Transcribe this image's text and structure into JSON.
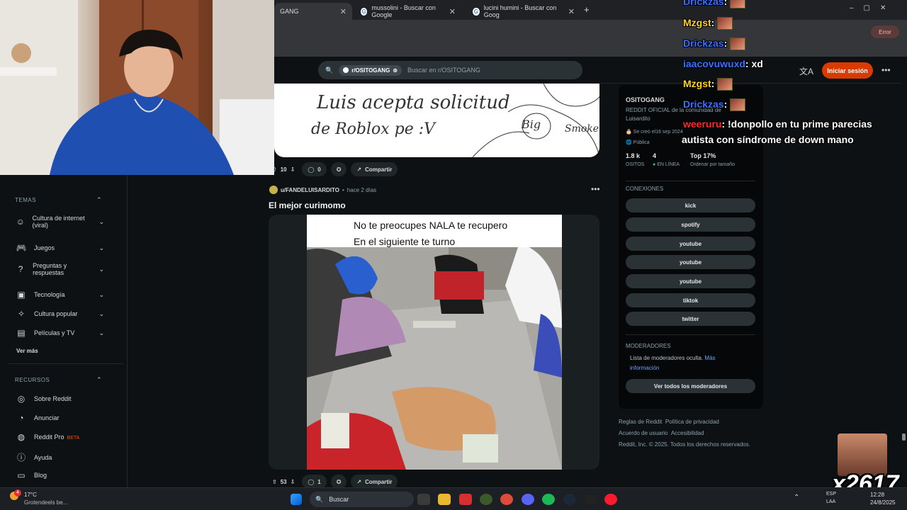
{
  "browser": {
    "tabs": [
      {
        "title": "GANG",
        "active": true
      },
      {
        "title": "mussolini - Buscar con Google"
      },
      {
        "title": "lucini humini - Buscar con Goog"
      }
    ],
    "new_tab": "+",
    "error_label": "Error"
  },
  "header": {
    "subreddit_chip": "r/OSITOGANG",
    "search_placeholder": "Buscar en r/OSITOGANG",
    "login": "Iniciar sesión"
  },
  "sidebar": {
    "temas_label": "TEMAS",
    "temas": [
      {
        "label": "Cultura de internet (viral)",
        "icon": "smile-icon"
      },
      {
        "label": "Juegos",
        "icon": "gamepad-icon"
      },
      {
        "label": "Preguntas y respuestas",
        "icon": "question-icon"
      },
      {
        "label": "Tecnología",
        "icon": "chip-icon"
      },
      {
        "label": "Cultura popular",
        "icon": "star-icon"
      },
      {
        "label": "Películas y TV",
        "icon": "film-icon"
      }
    ],
    "ver_mas": "Ver más",
    "recursos_label": "RECURSOS",
    "recursos": [
      {
        "label": "Sobre Reddit",
        "icon": "reddit-icon"
      },
      {
        "label": "Anunciar",
        "icon": "megaphone-icon"
      },
      {
        "label": "Reddit Pro",
        "badge": "BETA",
        "icon": "pro-icon"
      },
      {
        "label": "Ayuda",
        "icon": "help-icon"
      },
      {
        "label": "Blog",
        "icon": "book-icon"
      }
    ]
  },
  "post1": {
    "sketch_text_1": "Luis acepta solicitud",
    "sketch_text_2": "de Roblox pe :V",
    "sketch_text_3": "Big",
    "sketch_text_4": "Smoke",
    "votes": "10",
    "comments": "0",
    "share": "Compartir"
  },
  "post2": {
    "user": "u/FANDELUISARDITO",
    "time": "hace 2 días",
    "title": "El mejor curimomo",
    "caption_1": "No te preocupes NALA te recupero",
    "caption_2": "En el siguiente te turno",
    "votes": "53",
    "comments": "1",
    "share": "Compartir"
  },
  "community": {
    "name": "OSITOGANG",
    "description": "REDDIT OFICIAL de la comunidad de Luisardito",
    "created": "Se creó el16 sep 2024",
    "visibility": "Pública",
    "stat_members": "1.8 k",
    "stat_members_label": "OSITOS",
    "stat_online": "4",
    "stat_online_label": "EN LÍNEA",
    "rank": "Top 17%",
    "rank_label": "Ordenar por tamaño",
    "connections_label": "CONEXIONES",
    "connections": [
      "kick",
      "spotify",
      "youtube",
      "youtube",
      "youtube",
      "tiktok",
      "twitter"
    ],
    "moderators_label": "MODERADORES",
    "moderators_text": "Lista de moderadores oculta.",
    "moderators_link": "Más información",
    "moderators_button": "Ver todos los moderadores"
  },
  "footer": {
    "rules": "Reglas de Reddit",
    "privacy": "Política de privacidad",
    "agreement": "Acuerdo de usuario",
    "accessibility": "Accesibilidad",
    "copyright": "Reddit, Inc. © 2025. Todos los derechos reservados."
  },
  "chat": [
    {
      "user": "Drickzas",
      "color": "#3b6fff",
      "text": ":"
    },
    {
      "user": "Mzgst",
      "color": "#ffd21e",
      "text": ":"
    },
    {
      "user": "Drickzas",
      "color": "#3b6fff",
      "text": ":"
    },
    {
      "user": "iaacovuwuxd",
      "color": "#3b6fff",
      "text": ": xd"
    },
    {
      "user": "Mzgst",
      "color": "#ffd21e",
      "text": ":"
    },
    {
      "user": "Drickzas",
      "color": "#3b6fff",
      "text": ":"
    },
    {
      "user": "weeruru",
      "color": "#ff2a2a",
      "text": ": !donpollo en tu prime parecias"
    },
    {
      "user": "",
      "color": "#ffffff",
      "text": "autista con síndrome de down mano"
    }
  ],
  "overlay_counter": "x2617",
  "taskbar": {
    "weather_temp": "17°C",
    "weather_text": "Grotendeels be...",
    "weather_badge": "4",
    "search": "Buscar",
    "lang": "ESP",
    "lang2": "LAA",
    "time": "12:28",
    "date": "24/8/2025"
  }
}
